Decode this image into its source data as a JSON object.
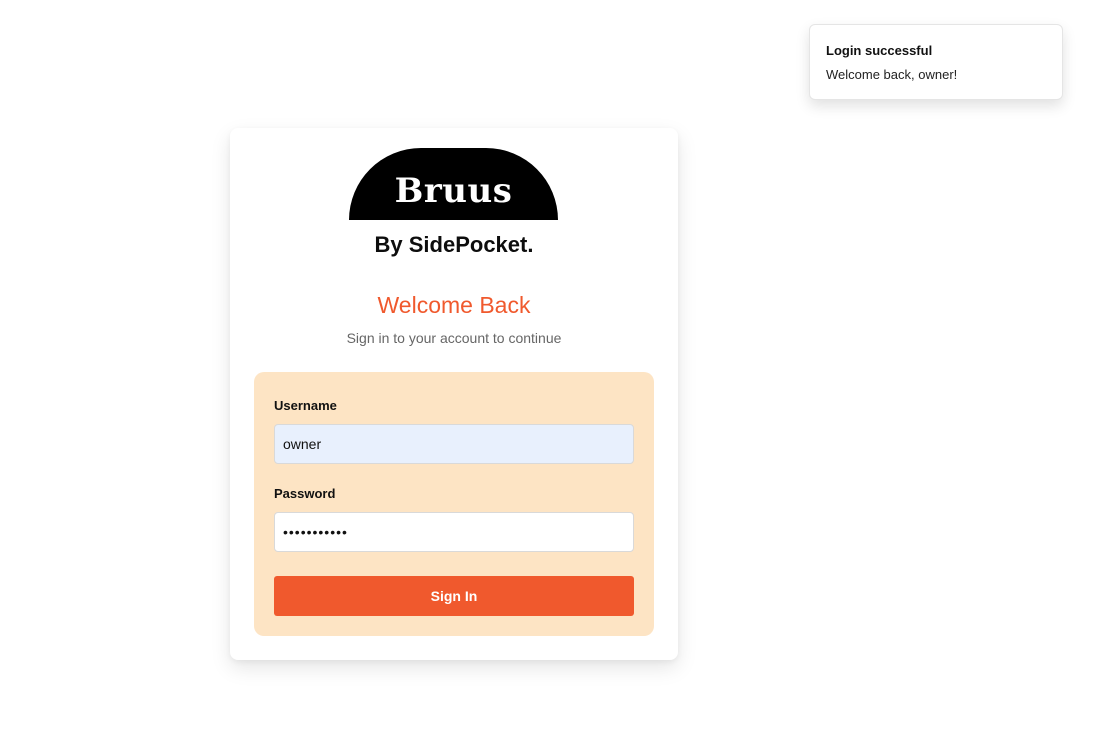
{
  "toast": {
    "title": "Login successful",
    "message": "Welcome back, owner!"
  },
  "brand": {
    "logo_text": "Bruus",
    "tagline": "By SidePocket."
  },
  "header": {
    "title": "Welcome Back",
    "subtitle": "Sign in to your account to continue"
  },
  "form": {
    "username_label": "Username",
    "username_value": "owner",
    "password_label": "Password",
    "password_value": "•••••••••••",
    "submit_label": "Sign In"
  },
  "colors": {
    "accent": "#f0592d",
    "panel": "#fde4c4",
    "autofill": "#e8f0fd"
  }
}
